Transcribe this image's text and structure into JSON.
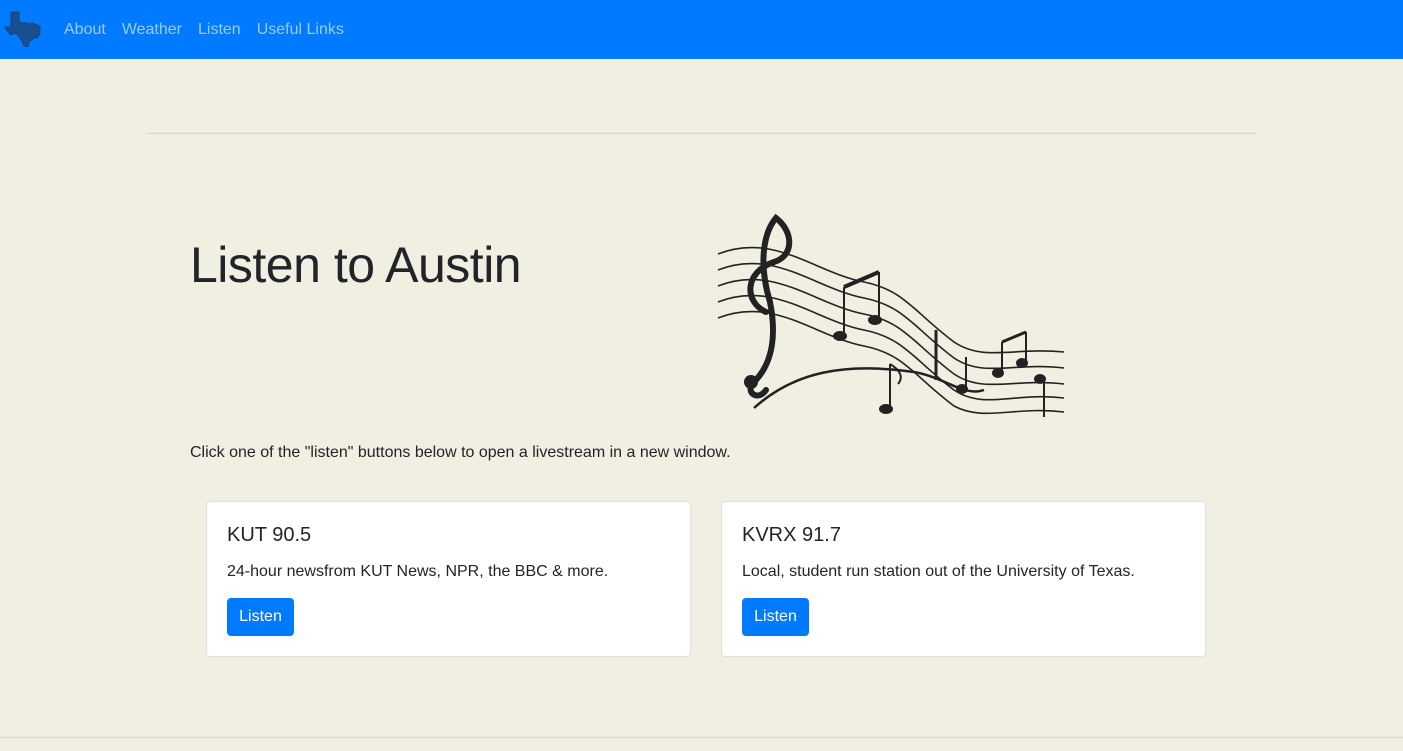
{
  "navbar": {
    "brand_icon": "texas-state-icon",
    "links": [
      {
        "label": "About"
      },
      {
        "label": "Weather"
      },
      {
        "label": "Listen"
      },
      {
        "label": "Useful Links"
      }
    ],
    "background": "#007bff"
  },
  "main": {
    "title": "Listen to Austin",
    "image": "music-staff-notes-illustration",
    "intro": "Click one of the \"listen\" buttons below to open a livestream in a new window."
  },
  "stations": [
    {
      "name": "KUT 90.5",
      "description": "24-hour newsfrom KUT News, NPR, the BBC & more.",
      "button_label": "Listen"
    },
    {
      "name": "KVRX 91.7",
      "description": "Local, student run station out of the University of Texas.",
      "button_label": "Listen"
    }
  ],
  "colors": {
    "page_background": "#f1eee2",
    "accent": "#007bff"
  }
}
